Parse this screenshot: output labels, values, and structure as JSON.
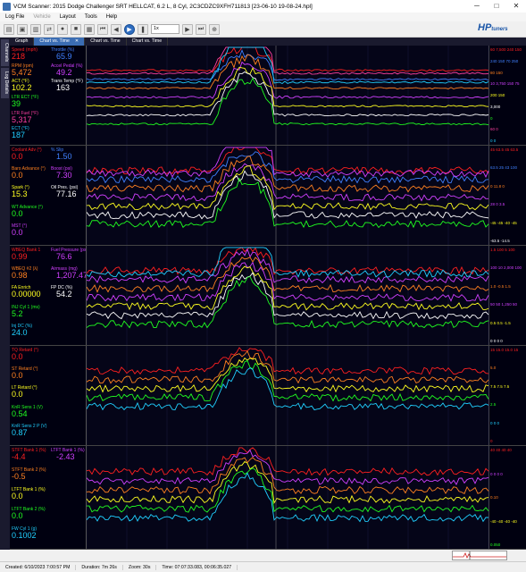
{
  "window": {
    "title": "VCM Scanner: 2015 Dodge Challenger SRT HELLCAT, 6.2 L, 8 Cyl, 2C3CDZC9XFH711813 [23-06-10 19-08-24.hpl]",
    "minimize": "─",
    "maximize": "□",
    "close": "✕"
  },
  "menu": [
    {
      "label": "Log File",
      "enabled": true
    },
    {
      "label": "Vehicle",
      "enabled": false
    },
    {
      "label": "Layout",
      "enabled": true
    },
    {
      "label": "Tools",
      "enabled": true
    },
    {
      "label": "Help",
      "enabled": true
    }
  ],
  "toolbar": {
    "speed_value": "1x",
    "logo_main": "HP",
    "logo_sub": "tuners"
  },
  "side_tabs": [
    "Channels",
    "Log Details"
  ],
  "tabs": [
    {
      "label": "Graph",
      "active": false
    },
    {
      "label": "Chart vs. Time",
      "active": true,
      "close": "✕"
    },
    {
      "label": "Chart vs. Time",
      "active": false
    },
    {
      "label": "Chart vs. Time",
      "active": false
    }
  ],
  "colors": {
    "red": "#ff2020",
    "cyan": "#20d0ff",
    "yellow": "#ffff20",
    "white": "#ffffff",
    "green": "#20ff20",
    "magenta": "#d040ff",
    "orange": "#ff8020",
    "pink": "#ff60c0",
    "blue": "#2080ff",
    "lime": "#a0ff40"
  },
  "panes": [
    {
      "channels": [
        {
          "label": "Speed (mph)",
          "value": "218",
          "color": "#ff2020"
        },
        {
          "label": "Throttle (%)",
          "value": "65.9",
          "color": "#4080ff"
        },
        {
          "label": "RPM (rpm)",
          "value": "5,472",
          "color": "#ff8020"
        },
        {
          "label": "Accel Pedal (%)",
          "value": "49.2",
          "color": "#d040ff"
        },
        {
          "label": "ACT (°F)",
          "value": "102.2",
          "color": "#ffff20"
        },
        {
          "label": "Trans Temp (°F)",
          "value": "163",
          "color": "#ffffff"
        },
        {
          "label": "LTR ECT (°F)",
          "value": "39",
          "color": "#20ff20"
        },
        {
          "label": "LTR Fuel (°F)",
          "value": "5,317",
          "color": "#ff40a0"
        },
        {
          "label": "ECT (°F)",
          "value": "187",
          "color": "#20d0ff"
        }
      ],
      "scale": [
        "60  7,500  240  150",
        "240  150  70  250",
        "80  150",
        "10  3,750  150  75",
        "200  150",
        "3,000",
        "0",
        "60  0",
        "0  0"
      ]
    },
    {
      "channels": [
        {
          "label": "Coolant Adv (°)",
          "value": "0.0",
          "color": "#ff2020"
        },
        {
          "label": "% Slip",
          "value": "1.50",
          "color": "#4080ff"
        },
        {
          "label": "Baro Advance (°)",
          "value": "0.0",
          "color": "#ff8020"
        },
        {
          "label": "Boost (psi)",
          "value": "7.30",
          "color": "#d040ff"
        },
        {
          "label": "Spark (°)",
          "value": "15.3",
          "color": "#ffff20"
        },
        {
          "label": "Oil Pres. (psi)",
          "value": "77.16",
          "color": "#ffffff"
        },
        {
          "label": "WT Advance (°)",
          "value": "0.0",
          "color": "#20ff20"
        },
        {
          "label": "MST (°)",
          "value": "0.0",
          "color": "#d040ff"
        }
      ],
      "scale": [
        "45  63.5  45  63.5",
        "63.5  25  43  100",
        "0  11.8  0",
        "28  0  3.5",
        "-45  -45  -40  -45",
        "-63.5  -14.5"
      ]
    },
    {
      "channels": [
        {
          "label": "WBEQ Bank 1",
          "value": "0.99",
          "color": "#ff2020"
        },
        {
          "label": "Fuel Pressure (psi)",
          "value": "76.6",
          "color": "#d040ff"
        },
        {
          "label": "WBEQ #2 (λ)",
          "value": "0.98",
          "color": "#ff8020"
        },
        {
          "label": "Airmass (mg)",
          "value": "1,207.47",
          "color": "#d040ff"
        },
        {
          "label": "FA Enrich",
          "value": "0.00000",
          "color": "#ffff20"
        },
        {
          "label": "FP DC (%)",
          "value": "54.2",
          "color": "#ffffff"
        },
        {
          "label": "INJ Cyl 1 (ms)",
          "value": "5.2",
          "color": "#20ff20"
        },
        {
          "label": "Inj DC (%)",
          "value": "24.0",
          "color": "#20d0ff"
        }
      ],
      "scale": [
        "1.5  100  5  100",
        "100  10  2,000  100",
        "1.0  -0.5  1.5",
        "50  50  1,250  50",
        "0.5  0.5  -1.5",
        "0  0  0  0"
      ]
    },
    {
      "channels": [
        {
          "label": "TQ Retard (°)",
          "value": "0.0",
          "color": "#ff2020"
        },
        {
          "label": "ST Retard (°)",
          "value": "0.0",
          "color": "#ff8020"
        },
        {
          "label": "LT Retard (°)",
          "value": "0.0",
          "color": "#ffff20"
        },
        {
          "label": "KnR Sens 1 (V)",
          "value": "0.54",
          "color": "#20ff20"
        },
        {
          "label": "KnR Sens 2 P (V)",
          "value": "0.87",
          "color": "#20d0ff"
        }
      ],
      "scale": [
        "15  15.0  15.0  15",
        "5.0",
        "7.5  7.5  7.5",
        "2.5",
        "0  0  0",
        "0"
      ]
    },
    {
      "channels": [
        {
          "label": "STFT Bank 1 (%)",
          "value": "-4.4",
          "color": "#ff2020"
        },
        {
          "label": "LTFT Bank 1 (%)",
          "value": "-2.43",
          "color": "#d040ff"
        },
        {
          "label": "STFT Bank 2 (%)",
          "value": "-0.5",
          "color": "#ff8020"
        },
        {
          "label": "LTFT Bank 1 (%)",
          "value": "0.0",
          "color": "#ffff20"
        },
        {
          "label": "LTFT Bank 2 (%)",
          "value": "0.0",
          "color": "#20ff20"
        },
        {
          "label": "FW Cyl 1 (g)",
          "value": "0.1002",
          "color": "#20d0ff"
        }
      ],
      "scale": [
        "40  40  40  40",
        "0  0  0  0",
        "0.10",
        "-40  -40  -40  -40",
        "0.050"
      ]
    }
  ],
  "status": {
    "created": "Created: 6/10/2023 7:00:57 PM",
    "duration": "Duration: 7m 26s",
    "zoom": "Zoom: 30s",
    "time": "Time: 07:07:33.083, 00:06:35.027"
  }
}
